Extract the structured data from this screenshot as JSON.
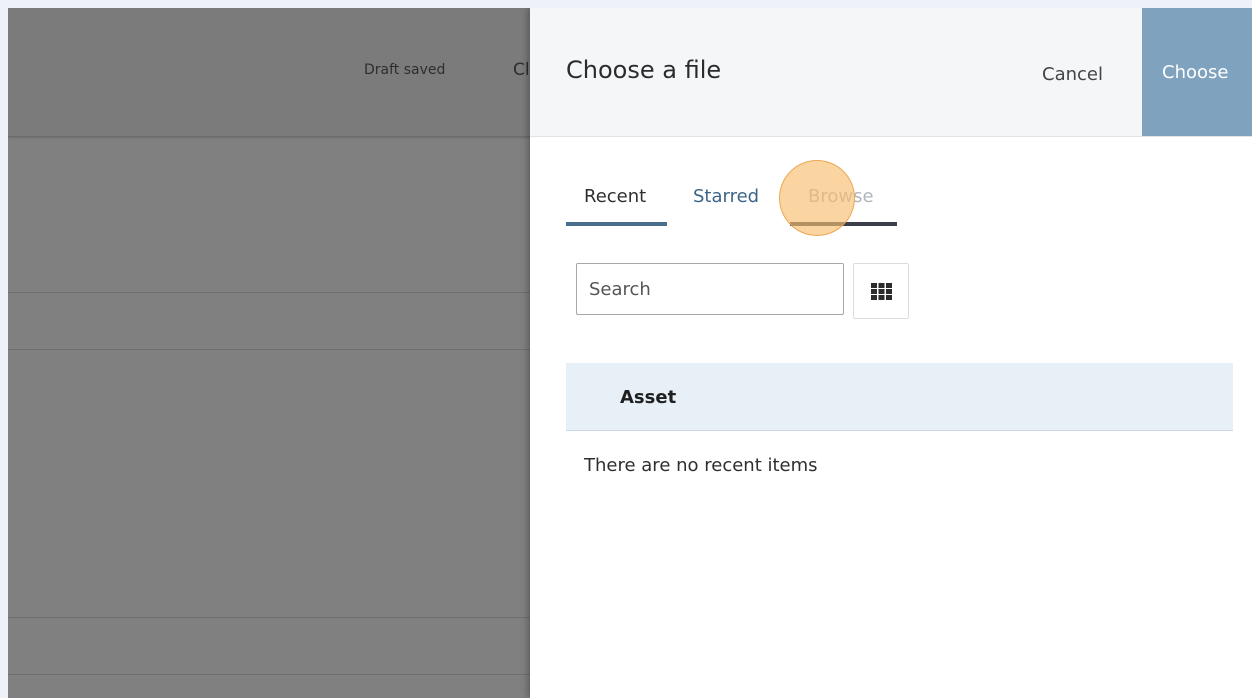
{
  "background": {
    "draft_status": "Draft saved",
    "cut_label": "Cl"
  },
  "panel": {
    "title": "Choose a file",
    "cancel_label": "Cancel",
    "choose_label": "Choose",
    "tabs": [
      {
        "label": "Recent",
        "active": true
      },
      {
        "label": "Starred",
        "active": false
      },
      {
        "label": "Browse",
        "active": false
      }
    ],
    "search": {
      "placeholder": "Search",
      "value": ""
    },
    "view_toggle_icon": "grid-icon",
    "table": {
      "columns": [
        "Asset"
      ],
      "empty_message": "There are no recent items"
    }
  },
  "colors": {
    "accent": "#4b6d8d",
    "choose_button": "#7fa2bf",
    "table_header_bg": "#e8f0f7",
    "overlay": "#808080",
    "click_indicator": "#f7be6e"
  }
}
